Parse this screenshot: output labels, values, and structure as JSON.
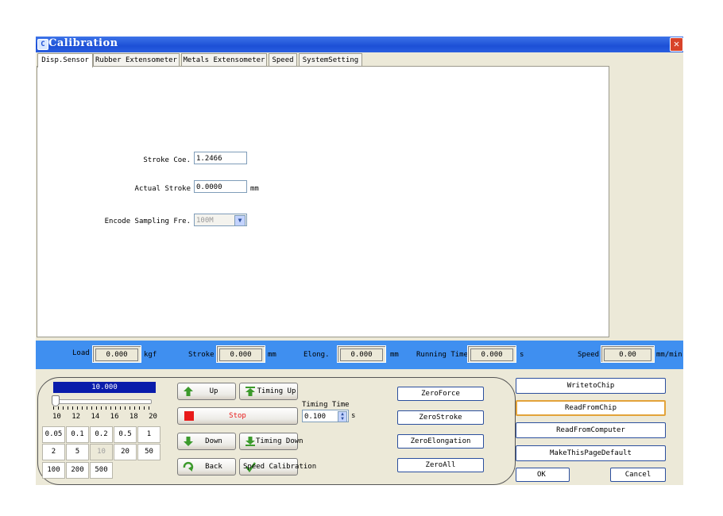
{
  "window": {
    "title": "Calibration",
    "close_glyph": "✕"
  },
  "tabs": [
    {
      "label": "Disp.Sensor",
      "active": true
    },
    {
      "label": "Rubber Extensometer"
    },
    {
      "label": "Metals Extensometer"
    },
    {
      "label": "Speed"
    },
    {
      "label": "SystemSetting"
    }
  ],
  "disp_sensor": {
    "stroke_coe_label": "Stroke Coe.",
    "stroke_coe_value": "1.2466",
    "actual_stroke_label": "Actual Stroke",
    "actual_stroke_value": "0.0000",
    "actual_stroke_unit": "mm",
    "encode_label": "Encode Sampling Fre.",
    "encode_value": "100M"
  },
  "status": {
    "load_label": "Load",
    "load_value": "0.000",
    "load_unit": "kgf",
    "stroke_label": "Stroke",
    "stroke_value": "0.000",
    "stroke_unit": "mm",
    "elong_label": "Elong.",
    "elong_value": "0.000",
    "elong_unit": "mm",
    "running_time_label": "Running Time",
    "running_time_value": "0.000",
    "running_time_unit": "s",
    "speed_label": "Speed",
    "speed_value": "0.00",
    "speed_unit": "mm/min"
  },
  "speed_control": {
    "speed_display": "10.000",
    "slider_fraction": 0.0,
    "scale_labels": [
      "10",
      "12",
      "14",
      "16",
      "18",
      "20"
    ],
    "steps": [
      "0.05",
      "0.1",
      "0.2",
      "0.5",
      "1",
      "2",
      "5",
      "10",
      "20",
      "50",
      "100",
      "200",
      "500"
    ],
    "selected_step": "10"
  },
  "motion": {
    "up": "Up",
    "timing_up": "Timing Up",
    "stop": "Stop",
    "down": "Down",
    "timing_down": "Timing Down",
    "back": "Back",
    "speed_calibration": "Speed Calibration",
    "timing_time_label": "Timing Time",
    "timing_time_value": "0.100",
    "timing_time_unit": "s"
  },
  "zero_buttons": {
    "zero_force": "ZeroForce",
    "zero_stroke": "ZeroStroke",
    "zero_elongation": "ZeroElongation",
    "zero_all": "ZeroAll"
  },
  "actions": {
    "write_to_chip": "WritetoChip",
    "read_from_chip": "ReadFromChip",
    "read_from_computer": "ReadFromComputer",
    "make_default": "MakeThisPageDefault",
    "ok": "OK",
    "cancel": "Cancel"
  },
  "colors": {
    "titlebar": "#1c4fd6",
    "statusbar": "#3f8ff0",
    "speed_display": "#0a1cab",
    "stop_icon": "#e81a1a",
    "arrow_icon": "#3c9a2c"
  }
}
